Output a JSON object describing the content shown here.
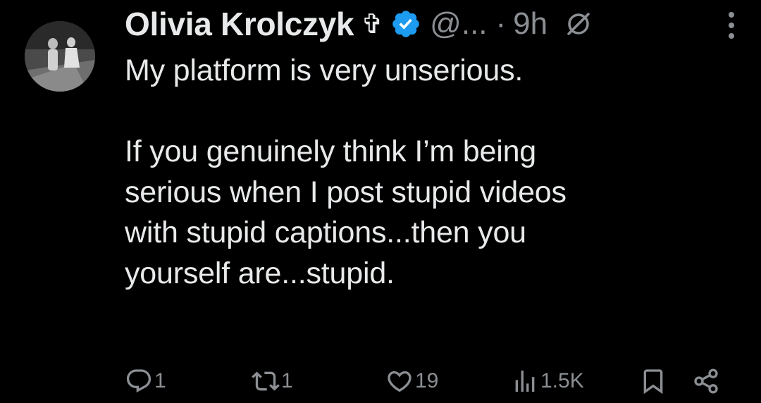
{
  "author": {
    "name": "Olivia Krolczyk",
    "cross_symbol": "✞",
    "verified": true,
    "handle": "@...",
    "separator": "·",
    "time": "9h"
  },
  "tweet": {
    "paragraphs": [
      [
        "My platform is very unserious."
      ],
      [
        "If you genuinely think I’m being",
        "serious when I post stupid videos",
        "with stupid captions...then you",
        "yourself are...stupid."
      ]
    ]
  },
  "actions": {
    "replies": "1",
    "reposts": "1",
    "likes": "19",
    "views": "1.5K"
  },
  "colors": {
    "background": "#000000",
    "text": "#e7e9ea",
    "secondary": "#8b8f93",
    "verified_blue": "#1d9bf0"
  },
  "icons": [
    "avatar",
    "cross-icon",
    "verified-icon",
    "no-entry-icon",
    "more-icon",
    "reply-icon",
    "repost-icon",
    "like-icon",
    "views-icon",
    "bookmark-icon",
    "share-icon"
  ]
}
